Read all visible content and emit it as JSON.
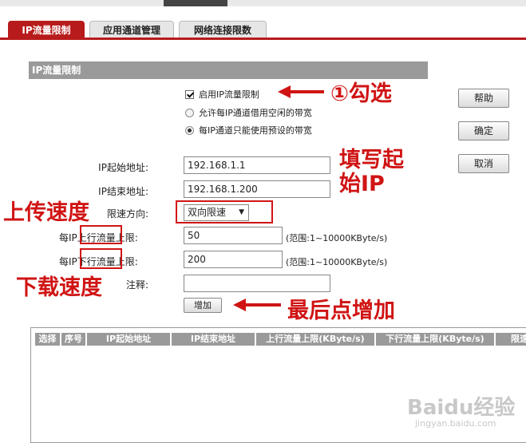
{
  "tabs": [
    {
      "label": "IP流量限制",
      "active": true
    },
    {
      "label": "应用通道管理",
      "active": false
    },
    {
      "label": "网络连接限数",
      "active": false
    }
  ],
  "section_title": "IP流量限制",
  "options": {
    "enable_label": "启用IP流量限制",
    "radio_borrow": "允许每IP通道借用空闲的带宽",
    "radio_preset": "每IP通道只能使用预设的带宽"
  },
  "side_buttons": {
    "help": "帮助",
    "ok": "确定",
    "cancel": "取消"
  },
  "form": {
    "start_ip_label": "IP起始地址:",
    "start_ip_value": "192.168.1.1",
    "end_ip_label": "IP结束地址:",
    "end_ip_value": "192.168.1.200",
    "direction_label": "限速方向:",
    "direction_value": "双向限速",
    "up_prefix": "每IP",
    "up_mid": "上行流量",
    "up_suffix": "上限:",
    "up_value": "50",
    "up_range": "(范围:1~10000KByte/s)",
    "down_prefix": "每IP",
    "down_mid": "下行流量",
    "down_suffix": "上限:",
    "down_value": "200",
    "down_range": "(范围:1~10000KByte/s)",
    "note_label": "注释:",
    "note_value": "",
    "add_button": "增加"
  },
  "annotations": {
    "check": "①勾选",
    "fill_line1": "填写起",
    "fill_line2": "始IP",
    "upload": "上传速度",
    "download": "下载速度",
    "finally": "最后点增加"
  },
  "table_headers": [
    "选择",
    "序号",
    "IP起始地址",
    "IP结束地址",
    "上行流量上限(KByte/s)",
    "下行流量上限(KByte/s)",
    "限速"
  ],
  "watermark": {
    "text": "Baidu经验",
    "sub": "jingyan.baidu.com"
  },
  "colors": {
    "accent": "#b81b1b",
    "annotation": "#d01414",
    "header_gray": "#9a9a9a"
  }
}
